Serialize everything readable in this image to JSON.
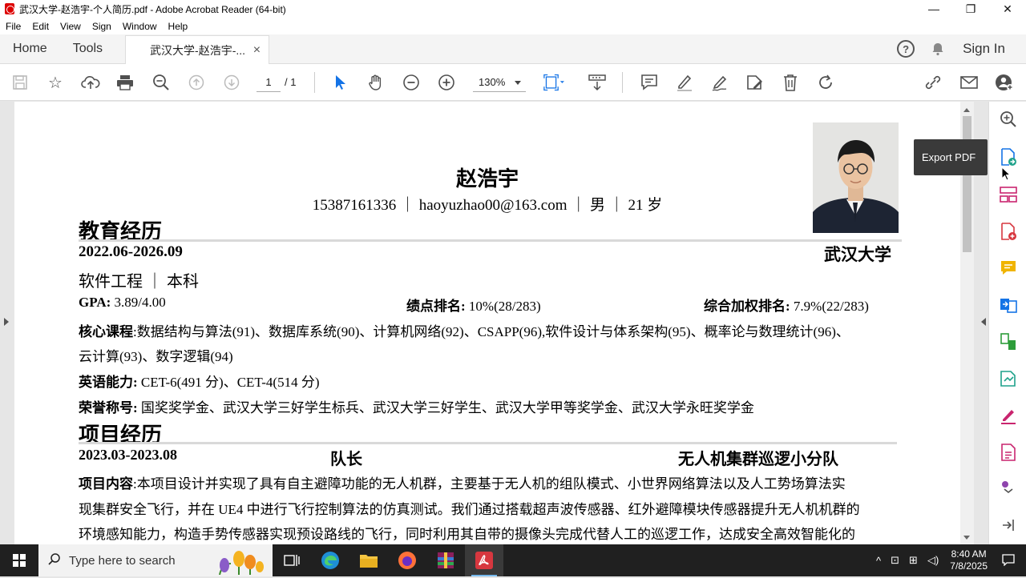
{
  "window": {
    "title": "武汉大学-赵浩宇-个人简历.pdf - Adobe Acrobat Reader (64-bit)",
    "minimize": "—",
    "maximize": "❐",
    "close": "✕"
  },
  "menu": [
    "File",
    "Edit",
    "View",
    "Sign",
    "Window",
    "Help"
  ],
  "tabs": {
    "home": "Home",
    "tools": "Tools",
    "document": "武汉大学-赵浩宇-...",
    "close": "×",
    "help": "?",
    "sign_in": "Sign In"
  },
  "toolbar": {
    "page_current": "1",
    "page_total": "/ 1",
    "zoom": "130%"
  },
  "resume": {
    "name": "赵浩宇",
    "contact": "15387161336 ｜ haoyuzhao00@163.com ｜ 男 ｜ 21 岁",
    "education": {
      "heading": "教育经历",
      "dates": "2022.06-2026.09",
      "school": "武汉大学",
      "major": "软件工程 ｜ 本科",
      "gpa_label": "GPA:",
      "gpa_value": "3.89/4.00",
      "gpa_rank_label": "绩点排名:",
      "gpa_rank_value": "10%(28/283)",
      "weighted_rank_label": "综合加权排名:",
      "weighted_rank_value": "7.9%(22/283)",
      "courses_label": "核心课程",
      "courses_line1": ":数据结构与算法(91)、数据库系统(90)、计算机网络(92)、CSAPP(96),软件设计与体系架构(95)、概率论与数理统计(96)、",
      "courses_line2": "云计算(93)、数字逻辑(94)",
      "english_label": "英语能力:",
      "english_value": "CET-6(491 分)、CET-4(514 分)",
      "honors_label": "荣誉称号:",
      "honors_value": "国奖奖学金、武汉大学三好学生标兵、武汉大学三好学生、武汉大学甲等奖学金、武汉大学永旺奖学金"
    },
    "projects": {
      "heading": "项目经历",
      "dates": "2023.03-2023.08",
      "role": "队长",
      "team": "无人机集群巡逻小分队",
      "content_label": "项目内容",
      "content_line1": ":本项目设计并实现了具有自主避障功能的无人机群，主要基于无人机的组队模式、小世界网络算法以及人工势场算法实",
      "content_line2": "现集群安全飞行，并在 UE4 中进行飞行控制算法的仿真测试。我们通过搭载超声波传感器、红外避障模块传感器提升无人机机群的",
      "content_line3": "环境感知能力，构造手势传感器实现预设路线的飞行，同时利用其自带的摄像头完成代替人工的巡逻工作，达成安全高效智能化的"
    }
  },
  "side_panel": {
    "tooltip": "Export PDF"
  },
  "taskbar": {
    "search_placeholder": "Type here to search",
    "time": "8:40 AM",
    "date": "7/8/2025"
  },
  "colors": {
    "acrobat_red": "#d7373f",
    "accent_blue": "#1473e6",
    "taskbar": "#202020"
  }
}
